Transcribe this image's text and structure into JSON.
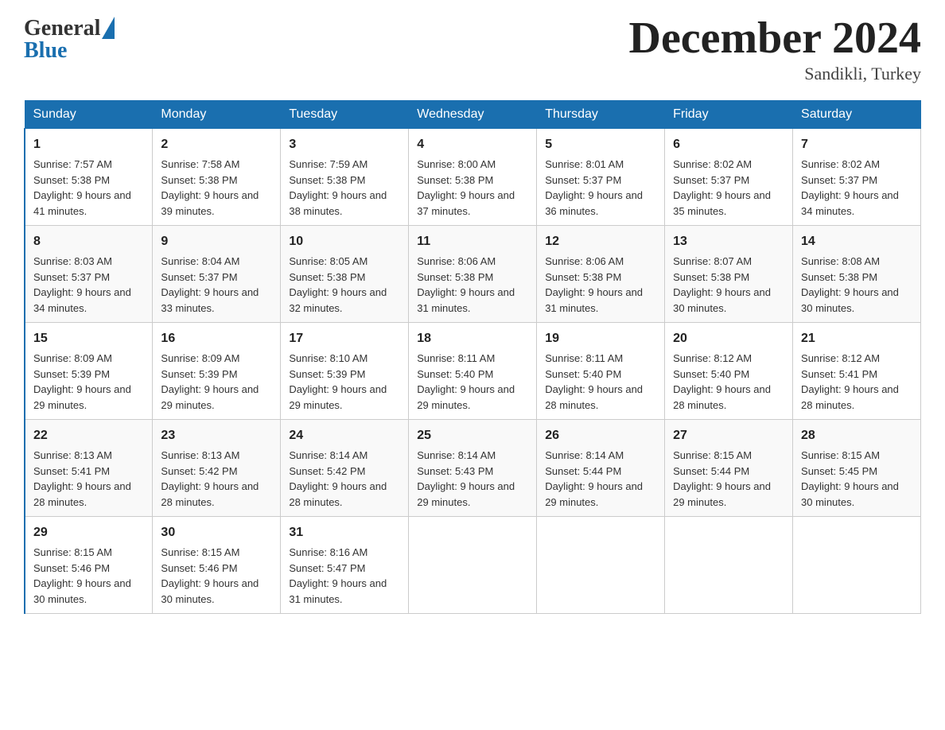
{
  "header": {
    "logo_general": "General",
    "logo_blue": "Blue",
    "title": "December 2024",
    "location": "Sandikli, Turkey"
  },
  "days_of_week": [
    "Sunday",
    "Monday",
    "Tuesday",
    "Wednesday",
    "Thursday",
    "Friday",
    "Saturday"
  ],
  "weeks": [
    [
      {
        "day": "1",
        "sunrise": "7:57 AM",
        "sunset": "5:38 PM",
        "daylight": "9 hours and 41 minutes."
      },
      {
        "day": "2",
        "sunrise": "7:58 AM",
        "sunset": "5:38 PM",
        "daylight": "9 hours and 39 minutes."
      },
      {
        "day": "3",
        "sunrise": "7:59 AM",
        "sunset": "5:38 PM",
        "daylight": "9 hours and 38 minutes."
      },
      {
        "day": "4",
        "sunrise": "8:00 AM",
        "sunset": "5:38 PM",
        "daylight": "9 hours and 37 minutes."
      },
      {
        "day": "5",
        "sunrise": "8:01 AM",
        "sunset": "5:37 PM",
        "daylight": "9 hours and 36 minutes."
      },
      {
        "day": "6",
        "sunrise": "8:02 AM",
        "sunset": "5:37 PM",
        "daylight": "9 hours and 35 minutes."
      },
      {
        "day": "7",
        "sunrise": "8:02 AM",
        "sunset": "5:37 PM",
        "daylight": "9 hours and 34 minutes."
      }
    ],
    [
      {
        "day": "8",
        "sunrise": "8:03 AM",
        "sunset": "5:37 PM",
        "daylight": "9 hours and 34 minutes."
      },
      {
        "day": "9",
        "sunrise": "8:04 AM",
        "sunset": "5:37 PM",
        "daylight": "9 hours and 33 minutes."
      },
      {
        "day": "10",
        "sunrise": "8:05 AM",
        "sunset": "5:38 PM",
        "daylight": "9 hours and 32 minutes."
      },
      {
        "day": "11",
        "sunrise": "8:06 AM",
        "sunset": "5:38 PM",
        "daylight": "9 hours and 31 minutes."
      },
      {
        "day": "12",
        "sunrise": "8:06 AM",
        "sunset": "5:38 PM",
        "daylight": "9 hours and 31 minutes."
      },
      {
        "day": "13",
        "sunrise": "8:07 AM",
        "sunset": "5:38 PM",
        "daylight": "9 hours and 30 minutes."
      },
      {
        "day": "14",
        "sunrise": "8:08 AM",
        "sunset": "5:38 PM",
        "daylight": "9 hours and 30 minutes."
      }
    ],
    [
      {
        "day": "15",
        "sunrise": "8:09 AM",
        "sunset": "5:39 PM",
        "daylight": "9 hours and 29 minutes."
      },
      {
        "day": "16",
        "sunrise": "8:09 AM",
        "sunset": "5:39 PM",
        "daylight": "9 hours and 29 minutes."
      },
      {
        "day": "17",
        "sunrise": "8:10 AM",
        "sunset": "5:39 PM",
        "daylight": "9 hours and 29 minutes."
      },
      {
        "day": "18",
        "sunrise": "8:11 AM",
        "sunset": "5:40 PM",
        "daylight": "9 hours and 29 minutes."
      },
      {
        "day": "19",
        "sunrise": "8:11 AM",
        "sunset": "5:40 PM",
        "daylight": "9 hours and 28 minutes."
      },
      {
        "day": "20",
        "sunrise": "8:12 AM",
        "sunset": "5:40 PM",
        "daylight": "9 hours and 28 minutes."
      },
      {
        "day": "21",
        "sunrise": "8:12 AM",
        "sunset": "5:41 PM",
        "daylight": "9 hours and 28 minutes."
      }
    ],
    [
      {
        "day": "22",
        "sunrise": "8:13 AM",
        "sunset": "5:41 PM",
        "daylight": "9 hours and 28 minutes."
      },
      {
        "day": "23",
        "sunrise": "8:13 AM",
        "sunset": "5:42 PM",
        "daylight": "9 hours and 28 minutes."
      },
      {
        "day": "24",
        "sunrise": "8:14 AM",
        "sunset": "5:42 PM",
        "daylight": "9 hours and 28 minutes."
      },
      {
        "day": "25",
        "sunrise": "8:14 AM",
        "sunset": "5:43 PM",
        "daylight": "9 hours and 29 minutes."
      },
      {
        "day": "26",
        "sunrise": "8:14 AM",
        "sunset": "5:44 PM",
        "daylight": "9 hours and 29 minutes."
      },
      {
        "day": "27",
        "sunrise": "8:15 AM",
        "sunset": "5:44 PM",
        "daylight": "9 hours and 29 minutes."
      },
      {
        "day": "28",
        "sunrise": "8:15 AM",
        "sunset": "5:45 PM",
        "daylight": "9 hours and 30 minutes."
      }
    ],
    [
      {
        "day": "29",
        "sunrise": "8:15 AM",
        "sunset": "5:46 PM",
        "daylight": "9 hours and 30 minutes."
      },
      {
        "day": "30",
        "sunrise": "8:15 AM",
        "sunset": "5:46 PM",
        "daylight": "9 hours and 30 minutes."
      },
      {
        "day": "31",
        "sunrise": "8:16 AM",
        "sunset": "5:47 PM",
        "daylight": "9 hours and 31 minutes."
      },
      null,
      null,
      null,
      null
    ]
  ],
  "labels": {
    "sunrise": "Sunrise:",
    "sunset": "Sunset:",
    "daylight": "Daylight:"
  }
}
